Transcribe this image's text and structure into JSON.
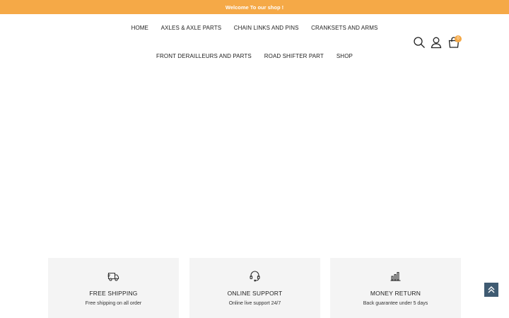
{
  "colors": {
    "accent": "#f5a947",
    "nav_text": "#222222",
    "feature_bg": "#f4f4f4",
    "back_to_top_bg": "#3f5b72"
  },
  "topbar": {
    "message": "Welcome To our shop !"
  },
  "nav": {
    "row1": [
      "HOME",
      "AXLES & AXLE PARTS",
      "CHAIN LINKS AND PINS",
      "CRANKSETS AND ARMS"
    ],
    "row2": [
      "FRONT DERAILLEURS AND PARTS",
      "ROAD SHIFTER PART",
      "SHOP"
    ]
  },
  "header_icons": {
    "search": "search-icon",
    "account": "user-icon",
    "cart": "cart-icon",
    "cart_count": "0"
  },
  "features": [
    {
      "icon": "truck-icon",
      "title": "FREE SHIPPING",
      "desc": "Free shipping on all order"
    },
    {
      "icon": "headset-icon",
      "title": "ONLINE SUPPORT",
      "desc": "Online live support 24/7"
    },
    {
      "icon": "bar-chart-icon",
      "title": "MONEY RETURN",
      "desc": "Back guarantee under 5 days"
    }
  ],
  "back_to_top": {
    "icon": "double-chevron-up-icon"
  }
}
